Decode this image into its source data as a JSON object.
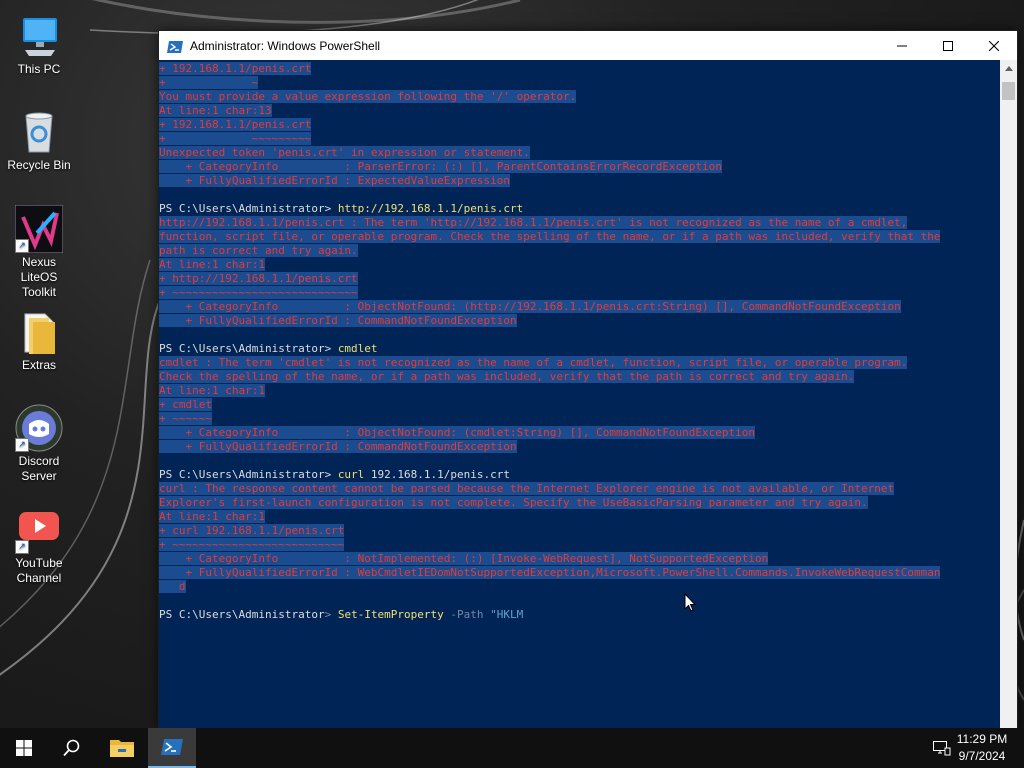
{
  "desktop": {
    "icons": [
      {
        "label": "This PC",
        "icon": "computer-icon"
      },
      {
        "label": "Recycle Bin",
        "icon": "recycle-bin-icon"
      },
      {
        "label": "Nexus LiteOS Toolkit",
        "icon": "nexus-toolkit-icon"
      },
      {
        "label": "Extras",
        "icon": "folder-icon"
      },
      {
        "label": "Discord Server",
        "icon": "discord-icon"
      },
      {
        "label": "YouTube Channel",
        "icon": "youtube-icon"
      }
    ]
  },
  "window": {
    "title": "Administrator: Windows PowerShell",
    "background": "#012456"
  },
  "console": {
    "lines": [
      {
        "parts": [
          {
            "t": "+ 192.168.1.1/penis.crt",
            "c": "red"
          }
        ]
      },
      {
        "parts": [
          {
            "t": "+             ~",
            "c": "red"
          }
        ]
      },
      {
        "parts": [
          {
            "t": "You must provide a value expression following the '/' operator.",
            "c": "red"
          }
        ]
      },
      {
        "parts": [
          {
            "t": "At line:1 char:13",
            "c": "red"
          }
        ]
      },
      {
        "parts": [
          {
            "t": "+ 192.168.1.1/penis.crt",
            "c": "red"
          }
        ]
      },
      {
        "parts": [
          {
            "t": "+             ~~~~~~~~~",
            "c": "red"
          }
        ]
      },
      {
        "parts": [
          {
            "t": "Unexpected token 'penis.crt' in expression or statement.",
            "c": "red"
          }
        ]
      },
      {
        "parts": [
          {
            "t": "    + CategoryInfo          : ParserError: (:) [], ParentContainsErrorRecordException",
            "c": "red"
          }
        ]
      },
      {
        "parts": [
          {
            "t": "    + FullyQualifiedErrorId : ExpectedValueExpression",
            "c": "red"
          }
        ]
      },
      {
        "parts": [
          {
            "t": "",
            "c": "white"
          }
        ]
      },
      {
        "parts": [
          {
            "t": "PS C:\\Users\\Administrator> ",
            "c": "white"
          },
          {
            "t": "http://192.168.1.1/penis.crt",
            "c": "yellow"
          }
        ]
      },
      {
        "parts": [
          {
            "t": "http://192.168.1.1/penis.crt : The term 'http://192.168.1.1/penis.crt' is not recognized as the name of a cmdlet,",
            "c": "red"
          }
        ]
      },
      {
        "parts": [
          {
            "t": "function, script file, or operable program. Check the spelling of the name, or if a path was included, verify that the",
            "c": "red"
          }
        ]
      },
      {
        "parts": [
          {
            "t": "path is correct and try again.",
            "c": "red"
          }
        ]
      },
      {
        "parts": [
          {
            "t": "At line:1 char:1",
            "c": "red"
          }
        ]
      },
      {
        "parts": [
          {
            "t": "+ http://192.168.1.1/penis.crt",
            "c": "red"
          }
        ]
      },
      {
        "parts": [
          {
            "t": "+ ~~~~~~~~~~~~~~~~~~~~~~~~~~~~",
            "c": "red"
          }
        ]
      },
      {
        "parts": [
          {
            "t": "    + CategoryInfo          : ObjectNotFound: (http://192.168.1.1/penis.crt:String) [], CommandNotFoundException",
            "c": "red"
          }
        ]
      },
      {
        "parts": [
          {
            "t": "    + FullyQualifiedErrorId : CommandNotFoundException",
            "c": "red"
          }
        ]
      },
      {
        "parts": [
          {
            "t": "",
            "c": "white"
          }
        ]
      },
      {
        "parts": [
          {
            "t": "PS C:\\Users\\Administrator> ",
            "c": "white"
          },
          {
            "t": "cmdlet",
            "c": "yellow"
          }
        ]
      },
      {
        "parts": [
          {
            "t": "cmdlet : The term 'cmdlet' is not recognized as the name of a cmdlet, function, script file, or operable program.",
            "c": "red"
          }
        ]
      },
      {
        "parts": [
          {
            "t": "Check the spelling of the name, or if a path was included, verify that the path is correct and try again.",
            "c": "red"
          }
        ]
      },
      {
        "parts": [
          {
            "t": "At line:1 char:1",
            "c": "red"
          }
        ]
      },
      {
        "parts": [
          {
            "t": "+ cmdlet",
            "c": "red"
          }
        ]
      },
      {
        "parts": [
          {
            "t": "+ ~~~~~~",
            "c": "red"
          }
        ]
      },
      {
        "parts": [
          {
            "t": "    + CategoryInfo          : ObjectNotFound: (cmdlet:String) [], CommandNotFoundException",
            "c": "red"
          }
        ]
      },
      {
        "parts": [
          {
            "t": "    + FullyQualifiedErrorId : CommandNotFoundException",
            "c": "red"
          }
        ]
      },
      {
        "parts": [
          {
            "t": "",
            "c": "white"
          }
        ]
      },
      {
        "parts": [
          {
            "t": "PS C:\\Users\\Administrator> ",
            "c": "white"
          },
          {
            "t": "curl",
            "c": "yellow"
          },
          {
            "t": " 192.168.1.1/penis.crt",
            "c": "white"
          }
        ]
      },
      {
        "parts": [
          {
            "t": "curl : The response content cannot be parsed because the Internet Explorer engine is not available, or Internet",
            "c": "red"
          }
        ]
      },
      {
        "parts": [
          {
            "t": "Explorer's first-launch configuration is not complete. Specify the UseBasicParsing parameter and try again.",
            "c": "red"
          }
        ]
      },
      {
        "parts": [
          {
            "t": "At line:1 char:1",
            "c": "red"
          }
        ]
      },
      {
        "parts": [
          {
            "t": "+ curl 192.168.1.1/penis.crt",
            "c": "red"
          }
        ]
      },
      {
        "parts": [
          {
            "t": "+ ~~~~~~~~~~~~~~~~~~~~~~~~~~",
            "c": "red"
          }
        ]
      },
      {
        "parts": [
          {
            "t": "    + CategoryInfo          : NotImplemented: (:) [Invoke-WebRequest], NotSupportedException",
            "c": "red"
          }
        ]
      },
      {
        "parts": [
          {
            "t": "    + FullyQualifiedErrorId : WebCmdletIEDomNotSupportedException,Microsoft.PowerShell.Commands.InvokeWebRequestComman",
            "c": "red"
          }
        ]
      },
      {
        "parts": [
          {
            "t": "   d",
            "c": "red"
          }
        ]
      },
      {
        "parts": [
          {
            "t": "",
            "c": "white"
          }
        ]
      },
      {
        "parts": [
          {
            "t": "PS C:\\Users\\Administrator",
            "c": "white"
          },
          {
            "t": ">",
            "c": "gray"
          },
          {
            "t": " Set-ItemProperty",
            "c": "yellow"
          },
          {
            "t": " -Path",
            "c": "gray"
          },
          {
            "t": " \"HKLM",
            "c": "cyan"
          }
        ]
      }
    ]
  },
  "taskbar": {
    "items": [
      {
        "label": "Start",
        "icon": "windows-start-icon"
      },
      {
        "label": "Search",
        "icon": "search-icon"
      },
      {
        "label": "File Explorer",
        "icon": "file-explorer-icon"
      },
      {
        "label": "Windows PowerShell",
        "icon": "powershell-icon"
      }
    ],
    "time": "11:29 PM",
    "date": "9/7/2024"
  }
}
